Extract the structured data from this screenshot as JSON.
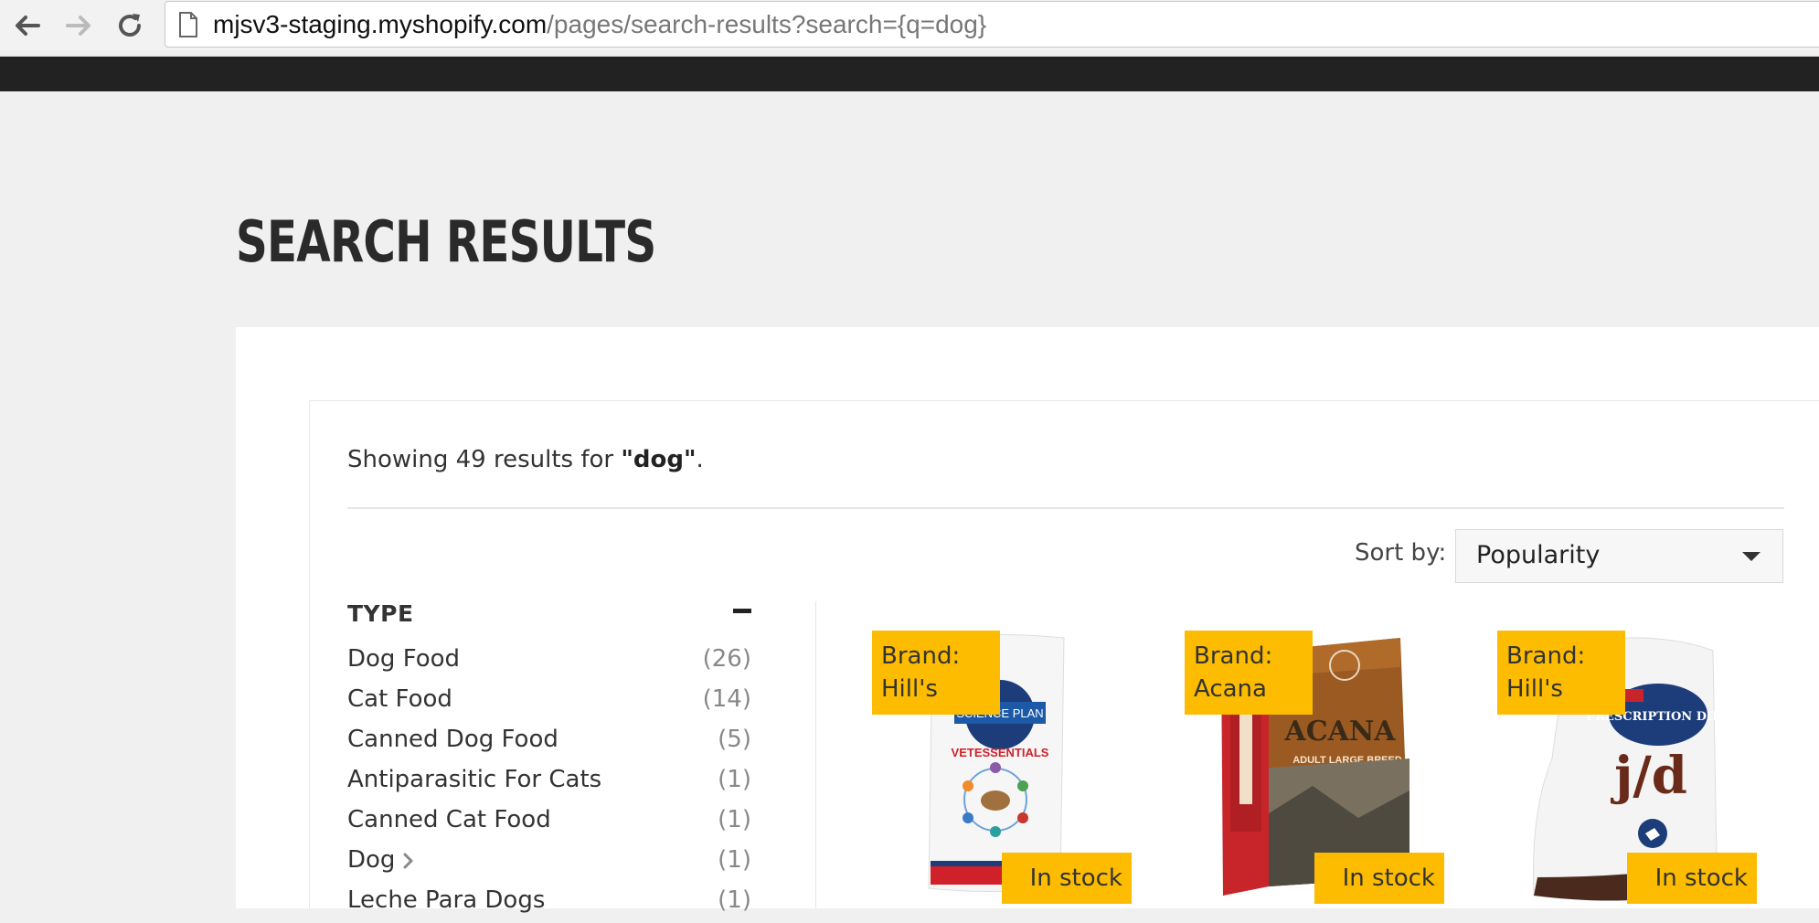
{
  "browser": {
    "url_host": "mjsv3-staging.myshopify.com",
    "url_path": "/pages/search-results?search={q=dog}",
    "icons": [
      "back-arrow-icon",
      "forward-arrow-icon",
      "reload-icon",
      "page-icon"
    ]
  },
  "page": {
    "title": "SEARCH RESULTS",
    "summary_prefix": "Showing 49 results for ",
    "summary_query": "\"dog\"",
    "summary_suffix": ".",
    "sort_label": "Sort by:",
    "sort_value": "Popularity"
  },
  "filter": {
    "heading": "TYPE",
    "items": [
      {
        "label": "Dog Food",
        "count": "(26)"
      },
      {
        "label": "Cat Food",
        "count": "(14)"
      },
      {
        "label": "Canned Dog Food",
        "count": "(5)"
      },
      {
        "label": "Antiparasitic For Cats",
        "count": "(1)"
      },
      {
        "label": "Canned Cat Food",
        "count": "(1)"
      },
      {
        "label": "Dog",
        "count": "(1)"
      },
      {
        "label": "Leche Para Dogs",
        "count": "(1)"
      }
    ]
  },
  "products": [
    {
      "brand_label": "Brand:",
      "brand": "Hill's",
      "stock": "In stock",
      "pack_text": "VETESSENTIALS",
      "pack_brand": "SCIENCE PLAN"
    },
    {
      "brand_label": "Brand:",
      "brand": "Acana",
      "stock": "In stock",
      "pack_text": "ADULT LARGE BREED",
      "pack_brand": "ACANA"
    },
    {
      "brand_label": "Brand:",
      "brand": "Hill's",
      "stock": "In stock",
      "pack_text": "j/d",
      "pack_brand": "PRESCRIPTION DIET"
    }
  ],
  "colors": {
    "badge": "#fdbc00",
    "header_bar": "#222222",
    "background": "#f0f0f0"
  }
}
